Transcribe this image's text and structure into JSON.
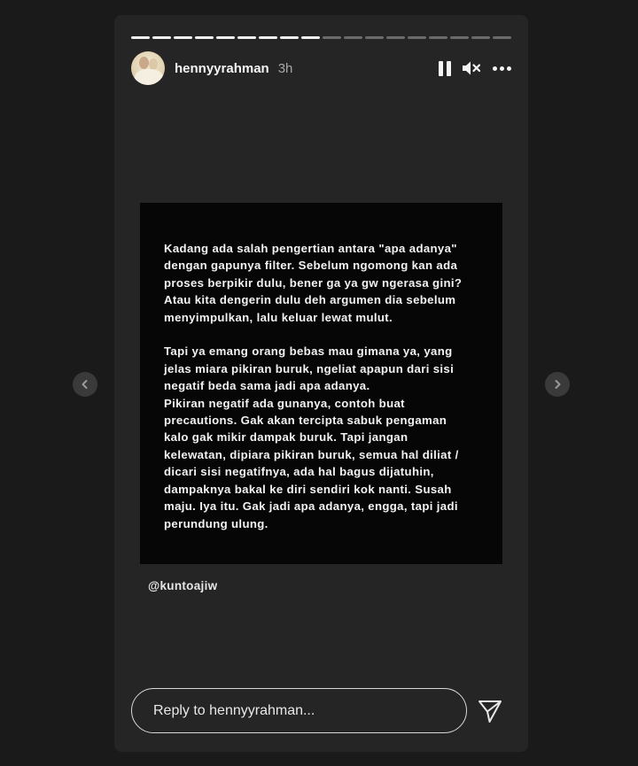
{
  "story": {
    "progress": {
      "total_segments": 18,
      "completed_segments": 9
    },
    "author": {
      "username": "hennyyrahman",
      "time_ago": "3h"
    },
    "controls": {
      "pause_icon": "pause-icon",
      "mute_icon": "muted-speaker-icon",
      "more_icon": "more-options-icon"
    },
    "media": {
      "text": "Kadang ada salah pengertian antara \"apa adanya\"\ndengan gapunya filter. Sebelum ngomong kan ada\nproses berpikir dulu, bener ga ya gw ngerasa gini?\nAtau kita dengerin dulu deh argumen dia sebelum\nmenyimpulkan, lalu keluar lewat mulut.\n\nTapi ya emang orang bebas mau gimana ya, yang\njelas miara pikiran buruk, ngeliat apapun dari sisi\nnegatif beda sama jadi apa adanya.\nPikiran negatif ada gunanya, contoh buat\nprecautions. Gak akan tercipta sabuk pengaman\nkalo gak mikir dampak buruk. Tapi jangan\nkelewatan, dipiara pikiran buruk, semua hal diliat /\ndicari sisi negatifnya, ada hal bagus dijatuhin,\ndampaknya bakal ke diri sendiri kok nanti. Susah\nmaju. Iya itu. Gak jadi apa adanya, engga, tapi jadi\nperundung ulung.",
      "mention": "@kuntoajiw"
    },
    "reply": {
      "placeholder": "Reply to hennyyrahman..."
    },
    "send_icon": "send-icon"
  },
  "navigation": {
    "prev_icon": "chevron-left-icon",
    "next_icon": "chevron-right-icon"
  },
  "colors": {
    "page_bg": "#1a1a1a",
    "story_bg": "#252525",
    "media_bg": "#060606",
    "text": "#f5f5f5",
    "muted": "#a8a8a8"
  }
}
